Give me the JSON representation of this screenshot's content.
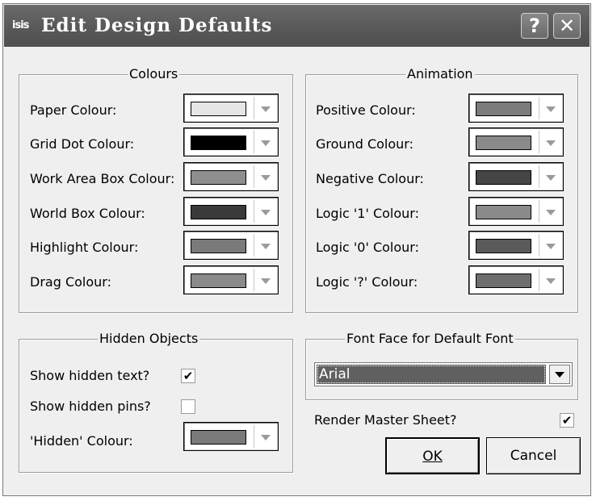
{
  "window": {
    "app_icon": "isis",
    "title": "Edit Design Defaults",
    "help_glyph": "?",
    "close_glyph": "✕"
  },
  "colours": {
    "legend": "Colours",
    "items": [
      {
        "label": "Paper Colour:",
        "color": "#e6e6e6"
      },
      {
        "label": "Grid Dot Colour:",
        "color": "#000000"
      },
      {
        "label": "Work Area Box Colour:",
        "color": "#8e8e8e"
      },
      {
        "label": "World Box Colour:",
        "color": "#3a3a3a"
      },
      {
        "label": "Highlight Colour:",
        "color": "#7a7a7a"
      },
      {
        "label": "Drag Colour:",
        "color": "#8a8a8a"
      }
    ]
  },
  "animation": {
    "legend": "Animation",
    "items": [
      {
        "label": "Positive Colour:",
        "color": "#7c7c7c"
      },
      {
        "label": "Ground Colour:",
        "color": "#8a8a8a"
      },
      {
        "label": "Negative Colour:",
        "color": "#454545"
      },
      {
        "label": "Logic '1' Colour:",
        "color": "#8a8a8a"
      },
      {
        "label": "Logic '0' Colour:",
        "color": "#5a5a5a"
      },
      {
        "label": "Logic '?' Colour:",
        "color": "#6e6e6e"
      }
    ]
  },
  "hidden_objects": {
    "legend": "Hidden Objects",
    "show_hidden_text_label": "Show hidden text?",
    "show_hidden_text_checked": true,
    "show_hidden_pins_label": "Show hidden pins?",
    "show_hidden_pins_checked": false,
    "hidden_colour_label": "'Hidden' Colour:",
    "hidden_colour": "#7a7a7a"
  },
  "font_face": {
    "legend": "Font Face for Default Font",
    "value": "Arial"
  },
  "render_master_sheet": {
    "label": "Render Master Sheet?",
    "checked": true
  },
  "buttons": {
    "ok": "OK",
    "cancel": "Cancel"
  },
  "check_glyph": "✔"
}
